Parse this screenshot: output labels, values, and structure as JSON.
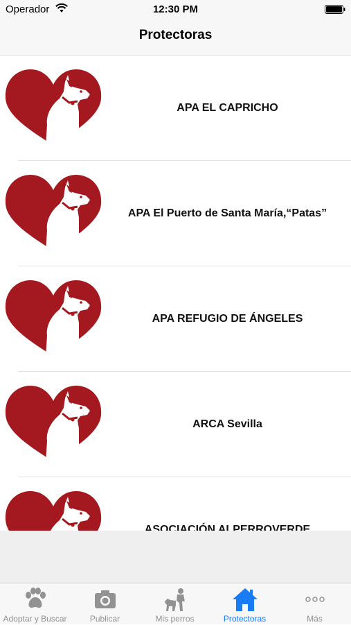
{
  "status_bar": {
    "carrier": "Operador",
    "time": "12:30 PM"
  },
  "nav": {
    "title": "Protectoras"
  },
  "colors": {
    "logo_red": "#a3191f",
    "accent": "#1a7cf5",
    "tab_inactive": "#929292"
  },
  "shelters": [
    {
      "name": "APA EL CAPRICHO",
      "icon": "heart-dog-logo"
    },
    {
      "name": "APA El Puerto de Santa María,“Patas”",
      "icon": "heart-dog-logo"
    },
    {
      "name": "APA REFUGIO DE ÁNGELES",
      "icon": "heart-dog-logo"
    },
    {
      "name": "ARCA Sevilla",
      "icon": "heart-dog-logo"
    },
    {
      "name": "ASOCIACIÓN ALPERROVERDE",
      "icon": "heart-dog-logo"
    }
  ],
  "tabs": [
    {
      "label": "Adoptar y Buscar",
      "icon": "paw-icon"
    },
    {
      "label": "Publicar",
      "icon": "camera-icon"
    },
    {
      "label": "Mis perros",
      "icon": "person-dog-icon"
    },
    {
      "label": "Protectoras",
      "icon": "house-icon",
      "active": true
    },
    {
      "label": "Más",
      "icon": "more-icon"
    }
  ]
}
